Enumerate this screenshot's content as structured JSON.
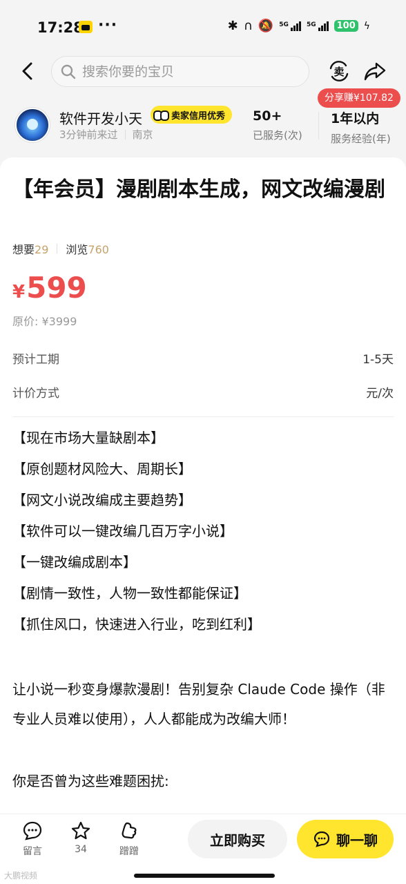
{
  "status_bar": {
    "time": "17:28",
    "more": "···",
    "net1": "5G",
    "net2": "5G",
    "battery": "100",
    "icons": [
      "app-notification-icon",
      "bluetooth-icon",
      "earbuds-icon",
      "mute-icon",
      "signal-icon",
      "charging-icon"
    ]
  },
  "header": {
    "search_placeholder": "搜索你要的宝贝",
    "sell_label": "卖",
    "share_earn": "分享赚¥107.82"
  },
  "seller": {
    "name": "软件开发小天",
    "badge": "卖家信用优秀",
    "last_seen": "3分钟前来过",
    "location": "南京",
    "served_value": "50+",
    "served_label": "已服务(次)",
    "experience_value": "1年以内",
    "experience_label": "服务经验(年)"
  },
  "item": {
    "title": "【年会员】漫剧剧本生成，网文改编漫剧",
    "want_label": "想要",
    "want_count": "29",
    "view_label": "浏览",
    "view_count": "760",
    "currency": "¥",
    "price": "599",
    "original_price": "原价: ¥3999",
    "duration_label": "预计工期",
    "duration_value": "1-5天",
    "pricing_label": "计价方式",
    "pricing_value": "元/次"
  },
  "description": {
    "bullets": [
      "【现在市场大量缺剧本】",
      "【原创题材风险大、周期长】",
      "【网文小说改编成主要趋势】",
      "【软件可以一键改编几百万字小说】",
      "【一键改编成剧本】",
      "【剧情一致性，人物一致性都能保证】",
      "【抓住风口，快速进入行业，吃到红利】"
    ],
    "paragraph1": "让小说一秒变身爆款漫剧！告别复杂 Claude Code 操作（非专业人员难以使用），人人都能成为改编大师！",
    "paragraph2": "你是否曾为这些难题困扰:"
  },
  "bottom_bar": {
    "comment_label": "留言",
    "favorite_count": "34",
    "nudge_label": "蹭蹭",
    "buy_label": "立即购买",
    "chat_label": "聊一聊",
    "watermark": "大鹏视频"
  }
}
